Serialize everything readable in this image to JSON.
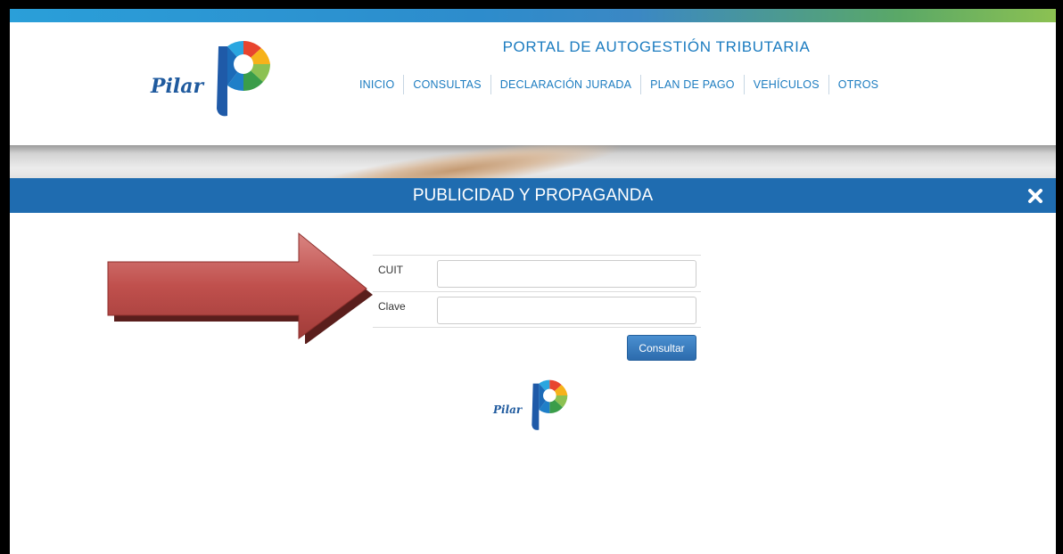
{
  "header": {
    "logo_text": "Pilar",
    "portal_title": "PORTAL DE AUTOGESTIÓN TRIBUTARIA",
    "nav": [
      {
        "label": "INICIO"
      },
      {
        "label": "CONSULTAS"
      },
      {
        "label": "DECLARACIÓN JURADA"
      },
      {
        "label": "PLAN DE PAGO"
      },
      {
        "label": "VEHÍCULOS"
      },
      {
        "label": "OTROS"
      }
    ]
  },
  "modal": {
    "title": "PUBLICIDAD Y PROPAGANDA",
    "close_icon": "close-icon",
    "form": {
      "cuit_label": "CUIT",
      "cuit_value": "",
      "clave_label": "Clave",
      "clave_value": "",
      "submit_label": "Consultar"
    },
    "footer_logo_text": "Pilar"
  },
  "annotation": {
    "icon": "red-arrow-icon",
    "color": "#c0504d"
  },
  "colors": {
    "accent_blue": "#1f6cb0",
    "nav_blue": "#1c7cc0",
    "logo_blue": "#1f5a9e"
  }
}
